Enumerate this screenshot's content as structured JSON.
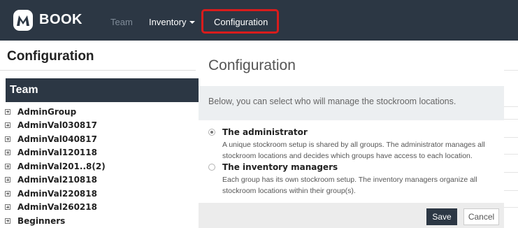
{
  "navbar": {
    "brand": "BOOK",
    "items": [
      "Team",
      "Inventory",
      "Configuration"
    ],
    "active_item": "Configuration",
    "highlight_color": "#d91c1c"
  },
  "page": {
    "title": "Configuration"
  },
  "team_panel": {
    "header": "Team",
    "groups": [
      "AdminGroup",
      "AdminVal030817",
      "AdminVal040817",
      "AdminVal120118",
      "AdminVal201..8(2)",
      "AdminVal210818",
      "AdminVal220818",
      "AdminVal260218",
      "Beginners"
    ]
  },
  "modal": {
    "title": "Configuration",
    "intro": "Below, you can select who will manage the stockroom locations.",
    "options": [
      {
        "title": "The administrator",
        "desc_line1": "A unique stockroom setup is shared by all groups. The administrator manages all",
        "desc_line2": "stockroom locations and decides which groups have access to each location.",
        "selected": true
      },
      {
        "title": "The inventory managers",
        "desc_line1": "Each group has its own stockroom setup. The inventory managers organize all",
        "desc_line2": "stockroom locations within their group(s).",
        "selected": false
      }
    ],
    "save_label": "Save",
    "cancel_label": "Cancel"
  },
  "colors": {
    "navbar_bg": "#2c3744",
    "accent": "#2c3744"
  }
}
